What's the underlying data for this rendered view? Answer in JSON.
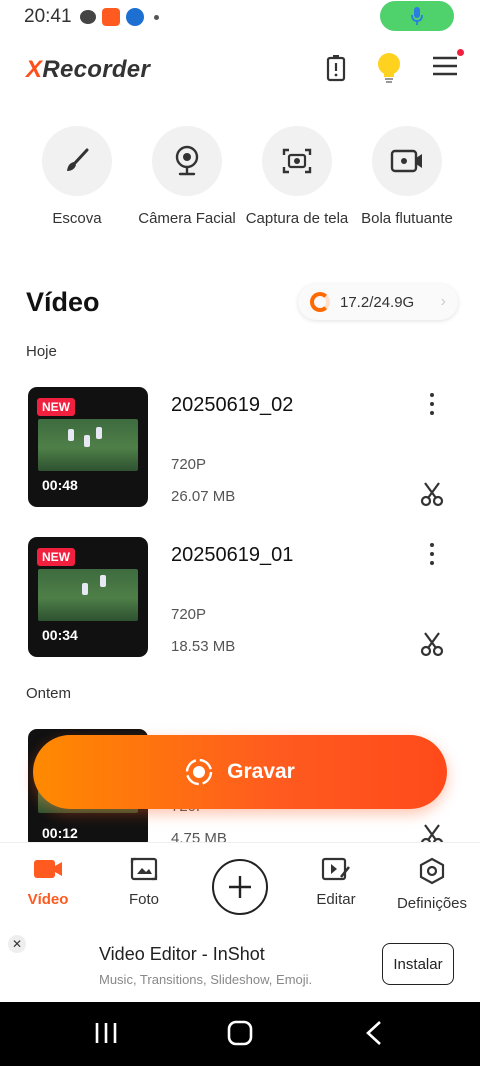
{
  "status_bar": {
    "time": "20:41"
  },
  "app": {
    "logo_x": "X",
    "logo_rest": "Recorder"
  },
  "tools": [
    {
      "label": "Escova",
      "icon": "brush-icon"
    },
    {
      "label": "Câmera Facial",
      "icon": "webcam-icon"
    },
    {
      "label": "Captura de tela",
      "icon": "screenshot-camera-icon"
    },
    {
      "label": "Bola flutuante",
      "icon": "floating-ball-icon"
    }
  ],
  "video_section": {
    "title": "Vídeo",
    "storage": "17.2/24.9G"
  },
  "groups": {
    "today": "Hoje",
    "yesterday": "Ontem"
  },
  "videos": [
    {
      "badge": "NEW",
      "duration": "00:48",
      "title": "20250619_02",
      "resolution": "720P",
      "size": "26.07 MB"
    },
    {
      "badge": "NEW",
      "duration": "00:34",
      "title": "20250619_01",
      "resolution": "720P",
      "size": "18.53 MB"
    },
    {
      "duration": "00:12",
      "resolution": "720P",
      "size": "4.75 MB"
    }
  ],
  "record_button": {
    "label": "Gravar"
  },
  "tabs": [
    {
      "label": "Vídeo",
      "active": true
    },
    {
      "label": "Foto"
    },
    {
      "label": "Editar"
    },
    {
      "label": "Definições"
    }
  ],
  "ad": {
    "title": "Video Editor - InShot",
    "subtitle": "Music, Transitions, Slideshow, Emoji.",
    "button": "Instalar",
    "close": "✕"
  },
  "colors": {
    "accent": "#ff5a1f",
    "new_badge": "#f0203e",
    "mic": "#4fd16c"
  }
}
